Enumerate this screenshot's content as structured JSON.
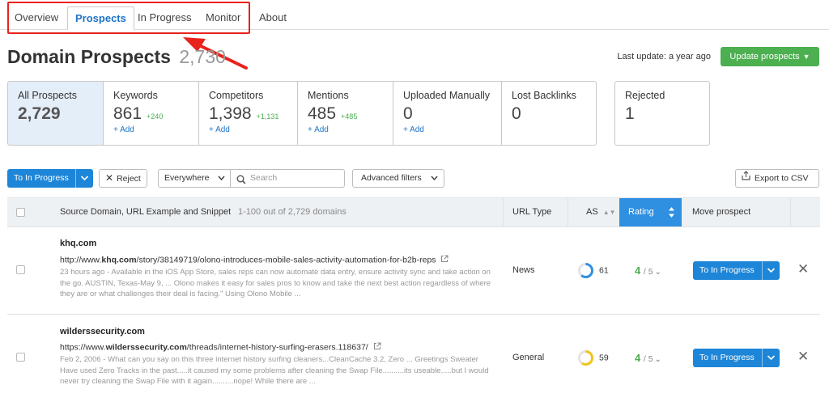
{
  "tabs": [
    {
      "label": "Overview"
    },
    {
      "label": "Prospects"
    },
    {
      "label": "In Progress"
    },
    {
      "label": "Monitor"
    },
    {
      "label": "About"
    }
  ],
  "header": {
    "title": "Domain Prospects",
    "count": "2,730",
    "last_update": "Last update: a year ago",
    "update_button": "Update prospects"
  },
  "cards": [
    {
      "label": "All Prospects",
      "value": "2,729"
    },
    {
      "label": "Keywords",
      "value": "861",
      "delta": "+240",
      "add": "+ Add"
    },
    {
      "label": "Competitors",
      "value": "1,398",
      "delta": "+1,131",
      "add": "+ Add"
    },
    {
      "label": "Mentions",
      "value": "485",
      "delta": "+485",
      "add": "+ Add"
    },
    {
      "label": "Uploaded Manually",
      "value": "0",
      "add": "+ Add"
    },
    {
      "label": "Lost Backlinks",
      "value": "0"
    },
    {
      "label": "Rejected",
      "value": "1"
    }
  ],
  "toolbar": {
    "to_in_progress": "To In Progress",
    "reject": "Reject",
    "scope": "Everywhere",
    "search_placeholder": "Search",
    "advanced_filters": "Advanced filters",
    "export": "Export to CSV"
  },
  "table": {
    "col_source": "Source Domain, URL Example and Snippet",
    "col_range": "1-100 out of 2,729 domains",
    "col_url_type": "URL Type",
    "col_as": "AS",
    "col_rating": "Rating",
    "col_move": "Move prospect",
    "rows": [
      {
        "domain": "khq.com",
        "url_prefix": "http://www.",
        "url_domain": "khq.com",
        "url_path": "/story/38149719/olono-introduces-mobile-sales-activity-automation-for-b2b-reps",
        "snippet": "23 hours ago - Available in the iOS App Store, sales reps can now automate data entry, ensure activity sync and take action on the go. AUSTIN, Texas-May 9, ... Olono makes it easy for sales pros to know and take the next best action regardless of where they are or what challenges their deal is facing.\" Using Olono Mobile ...",
        "type": "News",
        "as": "61",
        "as_fill": 0.61,
        "as_color": "#2f8fe1",
        "rating": "4",
        "rating_of": "/ 5",
        "move": "To In Progress"
      },
      {
        "domain": "wilderssecurity.com",
        "url_prefix": "https://www.",
        "url_domain": "wilderssecurity.com",
        "url_path": "/threads/internet-history-surfing-erasers.118637/",
        "snippet": "Feb 2, 2006 - What can you say on this three internet history surfing cleaners...CleanCache 3.2, Zero ... Greetings Sweater Have used Zero Tracks in the past.....it caused my some problems after cleaning the Swap File..........its useable.....but I would never try cleaning the Swap File with it again..........nope! While there are ...",
        "type": "General",
        "as": "59",
        "as_fill": 0.59,
        "as_color": "#f0c419",
        "rating": "4",
        "rating_of": "/ 5",
        "move": "To In Progress"
      }
    ]
  }
}
